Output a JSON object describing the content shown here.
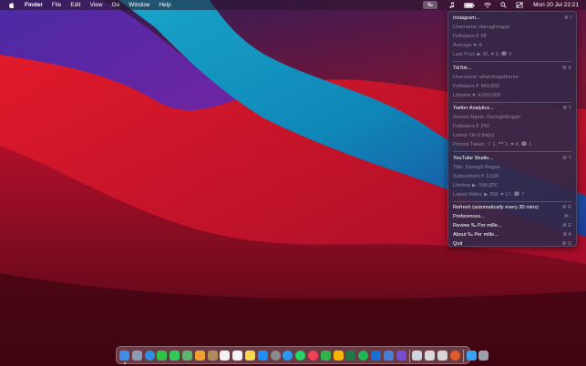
{
  "menubar": {
    "apple_icon": "apple-logo-icon",
    "items": [
      "Finder",
      "File",
      "Edit",
      "View",
      "Go",
      "Window",
      "Help"
    ],
    "app_label": "‰",
    "clock": "Mon 20 Jul  22:21",
    "status_icons": [
      "music-note-icon",
      "battery-icon",
      "wifi-icon",
      "search-icon",
      "control-center-icon"
    ]
  },
  "menu": {
    "instagram": {
      "title": "Instagram...",
      "shortcut": "⌘ I",
      "username": "Username: darraghrogan",
      "followers": "Followers 𝒇: 58",
      "average": "Average ♥: 8",
      "last_post": "Last Post: ▶ 36, ♥ 9, 💬 0"
    },
    "tiktok": {
      "title": "TikTok...",
      "shortcut": "⌘ K",
      "username": "Username: whatchugotforme",
      "followers": "Followers 𝒇: 469,800",
      "lifetime": "Lifetime ♥: 4,000,000"
    },
    "twitter": {
      "title": "Twitter Analytics...",
      "shortcut": "⌘ T",
      "screen_name": "Screen Name: DarraghRogan",
      "followers": "Followers 𝒇: 240",
      "listed": "Listed: On 0 list(s)",
      "pinned": "Pinned Tweet: ♲ 1, ❝❞ 1, ♥ 4, 💬 1"
    },
    "youtube": {
      "title": "YouTube Studio...",
      "shortcut": "⌘ Y",
      "channel_title": "Title: Darragh Rogan",
      "subscribers": "Subscribers 𝒇: 3,530",
      "lifetime": "Lifetime ▶: 595,826",
      "latest": "Latest Video: ▶ 258, ♥ 17, 💬 7"
    },
    "actions": [
      {
        "label": "Refresh (automatically every 30 mins)",
        "shortcut": "⌘ R"
      },
      {
        "label": "Preferences...",
        "shortcut": "⌘ ,"
      },
      {
        "label": "Review ‰ Per mille...",
        "shortcut": "⌘ E"
      },
      {
        "label": "About ‰ Per mille...",
        "shortcut": "⌘ A"
      },
      {
        "label": "Quit",
        "shortcut": "⌘ Q"
      }
    ]
  },
  "dock": {
    "apps": [
      {
        "name": "finder-icon",
        "color": "#3d8ee8"
      },
      {
        "name": "launchpad-icon",
        "color": "#8a9bb3"
      },
      {
        "name": "safari-icon",
        "color": "#2f8fe8"
      },
      {
        "name": "facetime-icon",
        "color": "#2fc24a"
      },
      {
        "name": "messages-icon",
        "color": "#34c759"
      },
      {
        "name": "maps-icon",
        "color": "#5db36b"
      },
      {
        "name": "photos-icon",
        "color": "#f0a030"
      },
      {
        "name": "contacts-icon",
        "color": "#b08a5a"
      },
      {
        "name": "calendar-icon",
        "color": "#f2f2f2"
      },
      {
        "name": "reminders-icon",
        "color": "#f5f5f5"
      },
      {
        "name": "notes-icon",
        "color": "#f7d94c"
      },
      {
        "name": "app-store-icon",
        "color": "#1e8ff5"
      },
      {
        "name": "system-preferences-icon",
        "color": "#8a8a8a"
      },
      {
        "name": "tweetbot-icon",
        "color": "#2a9af0"
      },
      {
        "name": "whatsapp-icon",
        "color": "#25d366"
      },
      {
        "name": "pocket-icon",
        "color": "#ef4056"
      },
      {
        "name": "numbers-icon",
        "color": "#30b04f"
      },
      {
        "name": "sketch-icon",
        "color": "#f7b500"
      },
      {
        "name": "excel-icon",
        "color": "#1f7a45"
      },
      {
        "name": "spotify-icon",
        "color": "#1db954"
      },
      {
        "name": "xcode-icon",
        "color": "#1a6fd0"
      },
      {
        "name": "text-editor-icon",
        "color": "#4a7fd6"
      },
      {
        "name": "per-mille-icon",
        "color": "#7a4dd6"
      },
      {
        "name": "preview-icon",
        "color": "#cfd6e0"
      },
      {
        "name": "activity-icon",
        "color": "#d9d9d9"
      },
      {
        "name": "script-editor-icon",
        "color": "#d5d5d5"
      },
      {
        "name": "x11-icon",
        "color": "#e05a2a"
      },
      {
        "name": "downloads-folder-icon",
        "color": "#3aa0f0"
      },
      {
        "name": "trash-icon",
        "color": "#9aa0a8"
      }
    ]
  }
}
